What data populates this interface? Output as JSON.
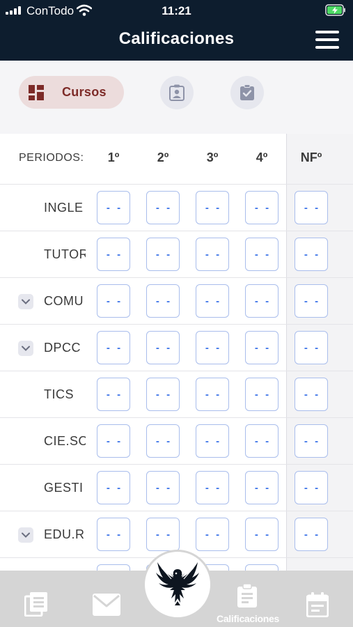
{
  "status_bar": {
    "carrier": "ConTodo",
    "time": "11:21"
  },
  "header": {
    "title": "Calificaciones"
  },
  "tabs": {
    "cursos_label": "Cursos"
  },
  "grid": {
    "periods_label": "PERIODOS:",
    "period_headers": [
      "1º",
      "2º",
      "3º",
      "4º"
    ],
    "final_header": "NFº",
    "rows": [
      {
        "name": "INGLE",
        "grades": [
          "- -",
          "- -",
          "- -",
          "- -",
          "- -"
        ]
      },
      {
        "name": "TUTOR",
        "grades": [
          "- -",
          "- -",
          "- -",
          "- -",
          "- -"
        ]
      },
      {
        "name": "COMU",
        "grades": [
          "- -",
          "- -",
          "- -",
          "- -",
          "- -"
        ]
      },
      {
        "name": "DPCC",
        "grades": [
          "- -",
          "- -",
          "- -",
          "- -",
          "- -"
        ]
      },
      {
        "name": "TICS",
        "grades": [
          "- -",
          "- -",
          "- -",
          "- -",
          "- -"
        ]
      },
      {
        "name": "CIE.SO",
        "grades": [
          "- -",
          "- -",
          "- -",
          "- -",
          "- -"
        ]
      },
      {
        "name": "GESTI",
        "grades": [
          "- -",
          "- -",
          "- -",
          "- -",
          "- -"
        ]
      },
      {
        "name": "EDU.R",
        "grades": [
          "- -",
          "- -",
          "- -",
          "- -",
          "- -"
        ]
      }
    ]
  },
  "bottom_nav": {
    "active_label": "Calificaciones"
  },
  "colors": {
    "header_bg": "#0d1d2e",
    "accent": "#7d2b28",
    "grade_text": "#3a72e8"
  }
}
